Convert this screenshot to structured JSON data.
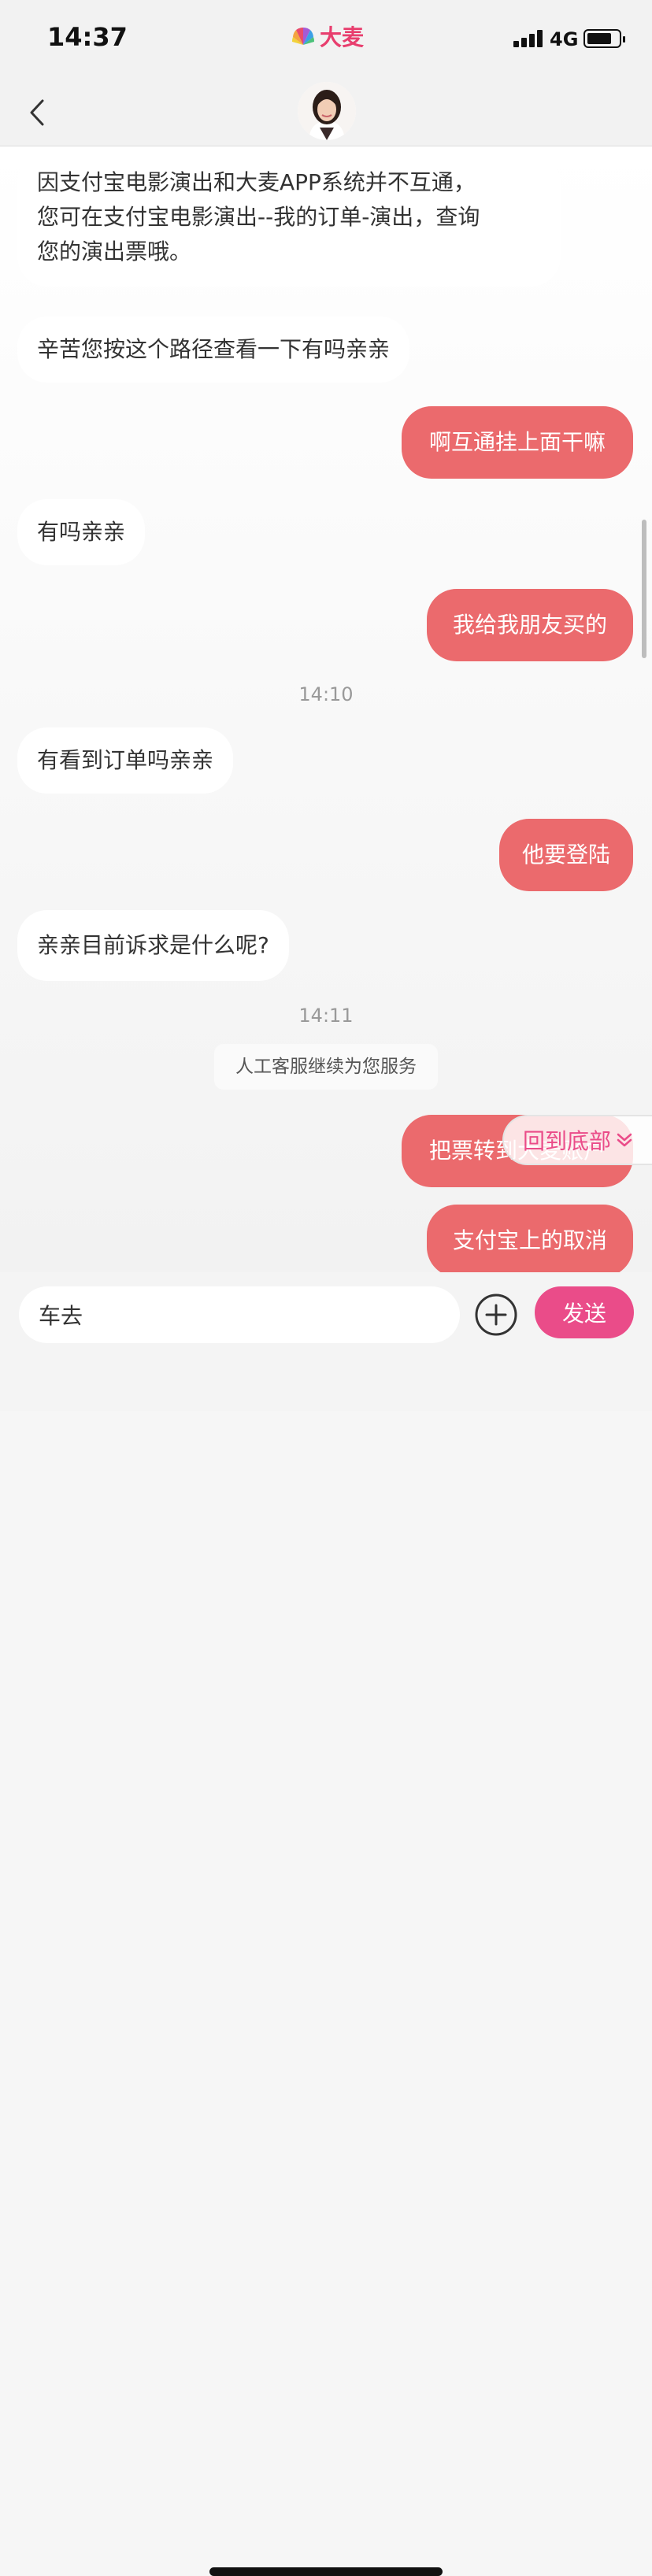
{
  "status_bar": {
    "time": "14:37",
    "network": "4G"
  },
  "brand": {
    "name": "大麦",
    "color": "#e83e6e"
  },
  "nav": {
    "back_icon": "chevron-left-icon",
    "avatar": "agent-avatar"
  },
  "messages": [
    {
      "from": "agent",
      "lines": [
        "因支付宝电影演出和大麦APP系统并不互通，",
        "您可在支付宝电影演出--我的订单-演出，查询",
        "您的演出票哦。"
      ]
    },
    {
      "from": "agent",
      "lines": [
        "辛苦您按这个路径查看一下有吗亲亲"
      ]
    },
    {
      "from": "user",
      "lines": [
        "啊互通挂上面干嘛"
      ]
    },
    {
      "from": "agent",
      "lines": [
        "有吗亲亲"
      ]
    },
    {
      "from": "user",
      "lines": [
        "我给我朋友买的"
      ]
    },
    {
      "type": "timestamp",
      "text": "14:10"
    },
    {
      "from": "agent",
      "lines": [
        "有看到订单吗亲亲"
      ]
    },
    {
      "from": "user",
      "lines": [
        "他要登陆"
      ]
    },
    {
      "from": "agent",
      "lines": [
        "亲亲目前诉求是什么呢?"
      ]
    },
    {
      "type": "timestamp",
      "text": "14:11"
    },
    {
      "type": "system",
      "text": "人工客服继续为您服务"
    },
    {
      "from": "user",
      "lines": [
        "把票转到大麦账户"
      ]
    },
    {
      "from": "user",
      "lines": [
        "支付宝上的取消"
      ]
    }
  ],
  "back_to_bottom": {
    "label": "回到底部",
    "icon": "double-chevron-down-icon"
  },
  "input": {
    "value": "车去",
    "placeholder": ""
  },
  "send_button": {
    "label": "发送"
  },
  "colors": {
    "user_bubble": "#eb6a6d",
    "send_button": "#ea4c89",
    "agent_bubble": "#ffffff"
  }
}
